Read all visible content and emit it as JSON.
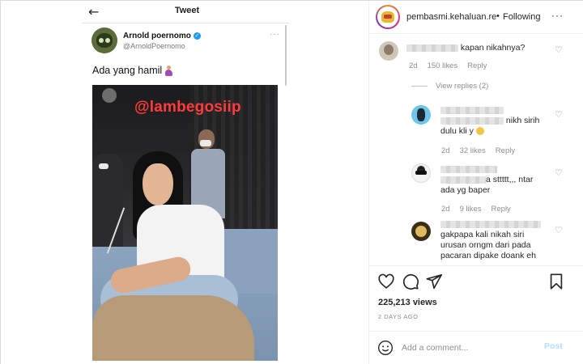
{
  "tweet": {
    "header_title": "Tweet",
    "author_name": "Arnold poernomo",
    "author_handle": "@ArnoldPoernomo",
    "more": "···",
    "text": "Ada yang hamil",
    "video_watermark": "@lambegosiip"
  },
  "post": {
    "username": "pembasmi.kehaluan.re",
    "dot": "•",
    "follow_status": "Following",
    "more": "···",
    "views": "225,213 views",
    "date": "2 DAYS AGO"
  },
  "comments": [
    {
      "text": "kapan nikahnya?",
      "time": "2d",
      "likes": "150 likes",
      "reply": "Reply",
      "view_replies": "View replies (2)"
    },
    {
      "text_line1": "nikh sirih",
      "text_line2": "dulu kli y",
      "time": "2d",
      "likes": "32 likes",
      "reply": "Reply"
    },
    {
      "text_line1": "a sttttt,,, ntar",
      "text_line2": "ada yg baper",
      "time": "2d",
      "likes": "9 likes",
      "reply": "Reply"
    },
    {
      "text_line1": "gakpapa kali nikah siri",
      "text_line2": "urusan orngm dari pada",
      "text_line3": "pacaran dipake doank eh"
    }
  ],
  "comment_box": {
    "placeholder": "Add a comment...",
    "post_label": "Post"
  },
  "colors": {
    "link_blue": "#0095f6",
    "post_disabled": "#b2dffc",
    "watermark_red": "#ff3b3b"
  }
}
